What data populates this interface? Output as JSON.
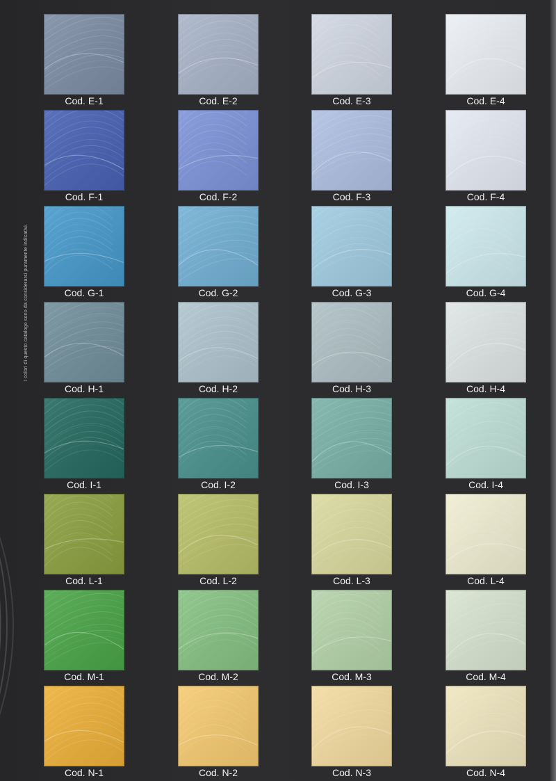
{
  "side_note": "I colori di questo catalogo sono da considerarsi puramente indicativi.",
  "rows": [
    {
      "swatches": [
        {
          "code": "Cod. E-1",
          "color": "#7c8aa0"
        },
        {
          "code": "Cod. E-2",
          "color": "#a3adc0"
        },
        {
          "code": "Cod. E-3",
          "color": "#c7cdd7"
        },
        {
          "code": "Cod. E-4",
          "color": "#dfe2e6"
        }
      ]
    },
    {
      "swatches": [
        {
          "code": "Cod. F-1",
          "color": "#4d63ad"
        },
        {
          "code": "Cod. F-2",
          "color": "#7c90cf"
        },
        {
          "code": "Cod. F-3",
          "color": "#aab8d7"
        },
        {
          "code": "Cod. F-4",
          "color": "#d8dde6"
        }
      ]
    },
    {
      "swatches": [
        {
          "code": "Cod. G-1",
          "color": "#4b95c3"
        },
        {
          "code": "Cod. G-2",
          "color": "#73aacb"
        },
        {
          "code": "Cod. G-3",
          "color": "#9cc3d6"
        },
        {
          "code": "Cod. G-4",
          "color": "#c5dee2"
        }
      ]
    },
    {
      "swatches": [
        {
          "code": "Cod. H-1",
          "color": "#718b97"
        },
        {
          "code": "Cod. H-2",
          "color": "#a9bcc5"
        },
        {
          "code": "Cod. H-3",
          "color": "#a8b8bc"
        },
        {
          "code": "Cod. H-4",
          "color": "#d4d9da"
        }
      ]
    },
    {
      "swatches": [
        {
          "code": "Cod. I-1",
          "color": "#2d6b62"
        },
        {
          "code": "Cod. I-2",
          "color": "#4e8f8b"
        },
        {
          "code": "Cod. I-3",
          "color": "#79aba3"
        },
        {
          "code": "Cod. I-4",
          "color": "#b7d4cd"
        }
      ]
    },
    {
      "swatches": [
        {
          "code": "Cod. L-1",
          "color": "#8a9b45"
        },
        {
          "code": "Cod. L-2",
          "color": "#b2b86a"
        },
        {
          "code": "Cod. L-3",
          "color": "#cfcf9a"
        },
        {
          "code": "Cod. L-4",
          "color": "#e3e1c8"
        }
      ]
    },
    {
      "swatches": [
        {
          "code": "Cod. M-1",
          "color": "#4ea04c"
        },
        {
          "code": "Cod. M-2",
          "color": "#84ba81"
        },
        {
          "code": "Cod. M-3",
          "color": "#adc9a4"
        },
        {
          "code": "Cod. M-4",
          "color": "#cdd8c6"
        }
      ]
    },
    {
      "swatches": [
        {
          "code": "Cod. N-1",
          "color": "#e0aa3e"
        },
        {
          "code": "Cod. N-2",
          "color": "#e8c171"
        },
        {
          "code": "Cod. N-3",
          "color": "#e6d09b"
        },
        {
          "code": "Cod. N-4",
          "color": "#e3dab7"
        }
      ]
    }
  ]
}
